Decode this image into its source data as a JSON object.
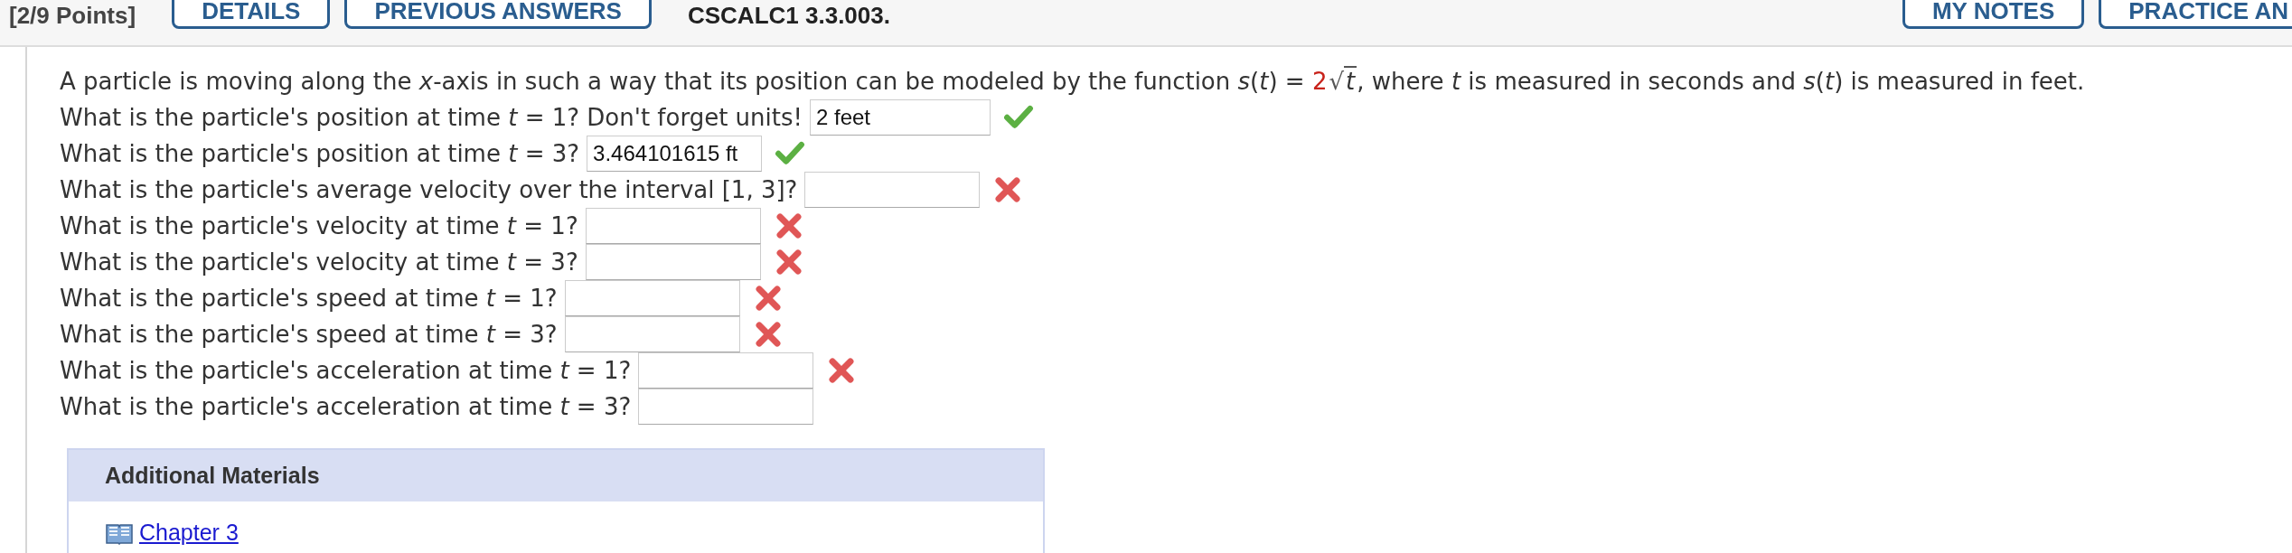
{
  "header": {
    "points": "[2/9 Points]",
    "left_buttons": [
      "DETAILS",
      "PREVIOUS ANSWERS"
    ],
    "problem_id": "CSCALC1 3.3.003.",
    "right_buttons": [
      "MY NOTES",
      "PRACTICE AN"
    ]
  },
  "question": {
    "intro_before": "A particle is moving along the *x*-axis in such a way that its position can be modeled by the function *s*(*t*) = ",
    "expression": {
      "coefficient": "2",
      "radical": "√",
      "radicand": "t"
    },
    "intro_after": ", where *t* is measured in seconds and *s*(*t*) is measured in feet.",
    "parts": [
      {
        "prompt": "What is the particle's position at time *t* = 1? Don't forget units!",
        "value": "2 feet",
        "graded": true,
        "correct": true
      },
      {
        "prompt": "What is the particle's position at time *t* = 3?",
        "value": "3.464101615 ft",
        "graded": true,
        "correct": true
      },
      {
        "prompt": "What is the particle's average velocity over the interval [1, 3]?",
        "graded": true,
        "correct": false
      },
      {
        "prompt": "What is the particle's velocity at time *t* = 1?",
        "graded": true,
        "correct": false
      },
      {
        "prompt": "What is the particle's velocity at time *t* = 3?",
        "graded": true,
        "correct": false
      },
      {
        "prompt": "What is the particle's speed at time *t* = 1?",
        "graded": true,
        "correct": false
      },
      {
        "prompt": "What is the particle's speed at time *t* = 3?",
        "graded": true,
        "correct": false
      },
      {
        "prompt": "What is the particle's acceleration at time *t* = 1?",
        "graded": true,
        "correct": false
      },
      {
        "prompt": "What is the particle's acceleration at time *t* = 3?",
        "graded": false
      }
    ]
  },
  "materials": {
    "title": "Additional Materials",
    "links": [
      "Chapter 3"
    ]
  }
}
